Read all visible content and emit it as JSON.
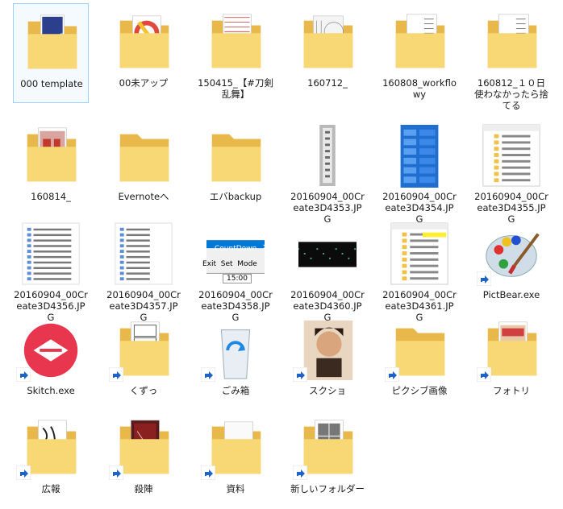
{
  "rows": [
    [
      {
        "label": "000 template",
        "kind": "folder",
        "art": "blue-photo",
        "selected": true
      },
      {
        "label": "00未アップ",
        "kind": "folder",
        "art": "paint"
      },
      {
        "label": "150415_【#刀剣乱舞】",
        "kind": "folder",
        "art": "manga"
      },
      {
        "label": "160712_",
        "kind": "folder",
        "art": "sketch"
      },
      {
        "label": "160808_workflowy",
        "kind": "folder",
        "art": "doc"
      },
      {
        "label": "160812_１０日使わなかったら捨てる",
        "kind": "folder",
        "art": "doc"
      }
    ],
    [
      {
        "label": "160814_",
        "kind": "folder",
        "art": "red-comic"
      },
      {
        "label": "Evernoteへ",
        "kind": "folder",
        "art": "empty"
      },
      {
        "label": "エバbackup",
        "kind": "folder",
        "art": "empty"
      },
      {
        "label": "20160904_00Create3D4353.JPG",
        "kind": "image",
        "art": "gray-strip"
      },
      {
        "label": "20160904_00Create3D4354.JPG",
        "kind": "image",
        "art": "blue-screen"
      },
      {
        "label": "20160904_00Create3D4355.JPG",
        "kind": "image",
        "art": "explorer"
      }
    ],
    [
      {
        "label": "20160904_00Create3D4356.JPG",
        "kind": "image",
        "art": "list"
      },
      {
        "label": "20160904_00Create3D4357.JPG",
        "kind": "image",
        "art": "list2"
      },
      {
        "label": "20160904_00Create3D4358.JPG",
        "kind": "image",
        "art": "countdown"
      },
      {
        "label": "20160904_00Create3D4360.JPG",
        "kind": "image",
        "art": "black"
      },
      {
        "label": "20160904_00Create3D4361.JPG",
        "kind": "image",
        "art": "explorer2"
      },
      {
        "label": "PictBear.exe",
        "kind": "app",
        "art": "palette"
      }
    ],
    [
      {
        "label": "Skitch.exe",
        "kind": "app",
        "art": "skitch"
      },
      {
        "label": "くずっ",
        "kind": "shortcut-folder",
        "art": "manga2"
      },
      {
        "label": "ごみ箱",
        "kind": "app",
        "art": "bin"
      },
      {
        "label": "スクショ",
        "kind": "shortcut-image",
        "art": "portrait"
      },
      {
        "label": "ピクシブ画像",
        "kind": "shortcut-folder",
        "art": "empty"
      },
      {
        "label": "フォトリ",
        "kind": "shortcut-folder",
        "art": "red-comic2"
      }
    ],
    [
      {
        "label": "広報",
        "kind": "shortcut-folder",
        "art": "ink"
      },
      {
        "label": "殺陣",
        "kind": "shortcut-folder",
        "art": "dark-red"
      },
      {
        "label": "資料",
        "kind": "shortcut-folder",
        "art": "paper"
      },
      {
        "label": "新しいフォルダー",
        "kind": "shortcut-folder",
        "art": "manga3"
      }
    ]
  ],
  "countdown": {
    "title": "CountDown",
    "menu": [
      "Exit",
      "Set",
      "Mode"
    ],
    "time": "15:00"
  },
  "colors": {
    "folder_back": "#e8b84a",
    "folder_front": "#f8d775",
    "selection": "#99d1ff"
  }
}
